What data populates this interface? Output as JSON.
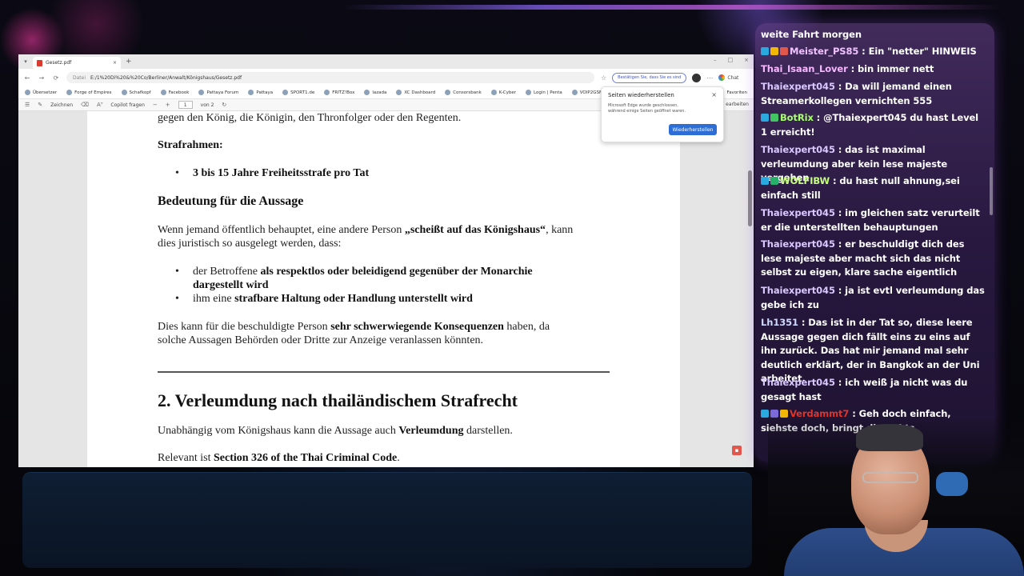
{
  "browser": {
    "tab_title": "Gesetz.pdf",
    "tab_close": "×",
    "new_tab": "+",
    "url_prefix": "Datei",
    "url": "E:/1%20Di%20&%20Co/Berliner/Anwalt/Königshaus/Gesetz.pdf",
    "signin_text": "Bestätigen Sie, dass Sie es sind",
    "chat_label": "Chat",
    "bookmarks": [
      "Übersetzer",
      "Forge of Empires",
      "Schafkopf",
      "Facebook",
      "Pattaya Forum",
      "Pattaya",
      "SPORT1.de",
      "FRITZ!Box",
      "lazada",
      "XC Dashboard",
      "Consorsbank",
      "K-Cyber",
      "Login | Penta",
      "VOIP2GSM"
    ],
    "bookmarks_more": "Favoriten",
    "pdf_toolbar": {
      "draw": "Zeichnen",
      "copilot": "Copilot fragen",
      "page": "1",
      "page_of": "von 2",
      "right": "earbeiten"
    },
    "popup": {
      "title": "Seiten wiederherstellen",
      "body": "Microsoft Edge wurde geschlossen, während einige Seiten geöffnet waren.",
      "button": "Wiederherstellen"
    }
  },
  "document": {
    "line_top": "gegen den König, die Königin, den Thronfolger oder den Regenten.",
    "strafrahmen_label": "Strafrahmen:",
    "strafrahmen_item": "3 bis 15 Jahre Freiheitsstrafe pro Tat",
    "bedeutung_heading": "Bedeutung für die Aussage",
    "para1_a": "Wenn jemand öffentlich behauptet, eine andere Person ",
    "para1_b": "„scheißt auf das Königshaus“",
    "para1_c": ", kann",
    "para1_d": "dies juristisch so ausgelegt werden, dass:",
    "bullet1_a": "der Betroffene ",
    "bullet1_b": "als respektlos oder beleidigend gegenüber der Monarchie",
    "bullet1_c": "dargestellt wird",
    "bullet2_a": "ihm eine ",
    "bullet2_b": "strafbare Haltung oder Handlung unterstellt wird",
    "para2_a": "Dies kann für die beschuldigte Person ",
    "para2_b": "sehr schwerwiegende Konsequenzen",
    "para2_c": " haben, da",
    "para2_d": "solche Aussagen Behörden oder Dritte zur Anzeige veranlassen könnten.",
    "section2_heading": "2. Verleumdung nach thailändischem Strafrecht",
    "para3_a": "Unabhängig vom Königshaus kann die Aussage auch ",
    "para3_b": "Verleumdung",
    "para3_c": " darstellen.",
    "para4_a": "Relevant ist ",
    "para4_b": "Section 326 of the Thai Criminal Code",
    "para4_c": "."
  },
  "chat": {
    "messages": [
      {
        "user": "",
        "text": "weite Fahrt morgen",
        "color": "#ffffff"
      },
      {
        "user": "Meister_PS85",
        "text": " : Ein \"netter\" HINWEIS",
        "color": "#f0c2ff",
        "badges": [
          "#2aa9e0",
          "#f2b705",
          "#e2574c"
        ]
      },
      {
        "user": "Thai_Isaan_Lover",
        "text": " : bin immer nett",
        "color": "#f7b7ff"
      },
      {
        "user": "Thaiexpert045",
        "text": " : Da will jemand einen Streamerkollegen vernichten 555",
        "color": "#d9c7ff"
      },
      {
        "user": "BotRix",
        "text": " : @Thaiexpert045 du hast Level 1 erreicht!",
        "color": "#a6ff6b",
        "badges": [
          "#2aa9e0",
          "#42c462"
        ]
      },
      {
        "user": "Thaiexpert045",
        "text": " : das ist maximal verleumdung aber kein lese majeste vergehen",
        "color": "#d9c7ff"
      },
      {
        "user": "WOLFIBW",
        "text": " : du hast null ahnung,sei einfach still",
        "color": "#c5ff7c",
        "badges": [
          "#2aa9e0",
          "#26b06a"
        ]
      },
      {
        "user": "Thaiexpert045",
        "text": " : im gleichen satz verurteilt er die unterstellten behauptungen",
        "color": "#d9c7ff"
      },
      {
        "user": "Thaiexpert045",
        "text": " : er beschuldigt dich des lese majeste aber macht sich das nicht selbst zu eigen, klare sache eigentlich",
        "color": "#d9c7ff"
      },
      {
        "user": "Thaiexpert045",
        "text": " : ja ist evtl verleumdung das gebe ich zu",
        "color": "#d9c7ff"
      },
      {
        "user": "Lh1351",
        "text": " : Das ist in der Tat so, diese leere Aussage gegen dich fällt eins zu eins auf ihn zurück. Das hat mir jemand mal sehr deutlich erklärt, der in Bangkok an der Uni arbeitet. ",
        "color": "#cfd8ff"
      },
      {
        "user": "Thaiexpert045",
        "text": " : ich weiß ja nicht was du gesagt hast",
        "color": "#d9c7ff"
      },
      {
        "user": "Verdammt7",
        "text": " : Geh doch einfach, siehste doch, bringt dir nichts.",
        "color": "#e0342b",
        "badges": [
          "#2aa9e0",
          "#7b6ad8",
          "#f2b705"
        ]
      }
    ]
  },
  "icons": {
    "back": "←",
    "forward": "→",
    "reload": "⟳",
    "star": "☆",
    "more": "⋯",
    "close": "×",
    "pdf": "PDF"
  }
}
